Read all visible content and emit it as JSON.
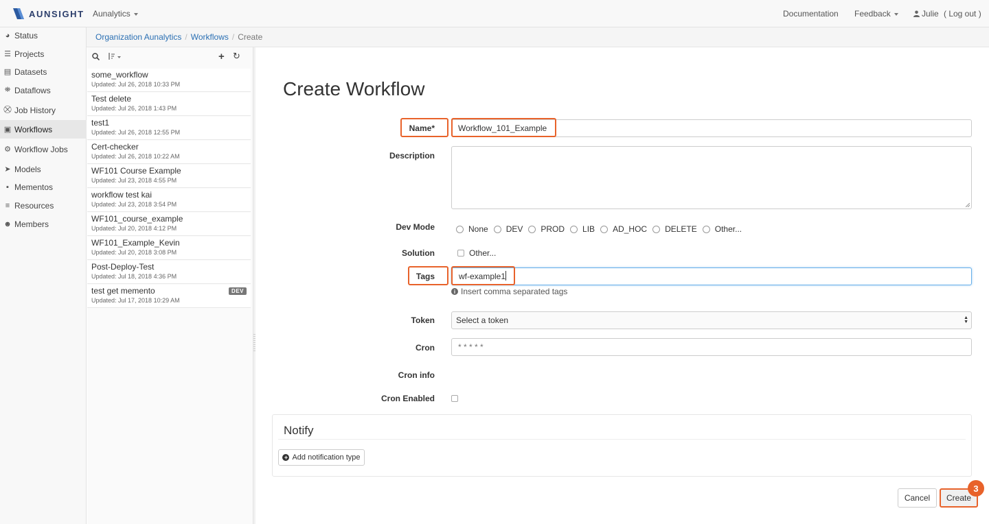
{
  "navbar": {
    "brand": "AUNSIGHT",
    "org_menu": "Aunalytics",
    "documentation": "Documentation",
    "feedback": "Feedback",
    "user": "Julie",
    "logout": "( Log out )"
  },
  "breadcrumb": {
    "items": [
      "Organization Aunalytics",
      "Workflows"
    ],
    "current": "Create"
  },
  "sidebar": {
    "items": [
      {
        "label": "Status",
        "icon": "dashboard-icon"
      },
      {
        "label": "Projects",
        "icon": "list-icon"
      },
      {
        "label": "Datasets",
        "icon": "document-icon"
      },
      {
        "label": "Dataflows",
        "icon": "sitemap-icon"
      },
      {
        "label": "Job History",
        "icon": "job-history-icon"
      },
      {
        "label": "Workflows",
        "icon": "workflow-icon"
      },
      {
        "label": "Workflow Jobs",
        "icon": "workflow-jobs-icon"
      },
      {
        "label": "Models",
        "icon": "models-icon"
      },
      {
        "label": "Mementos",
        "icon": "bookmark-icon"
      },
      {
        "label": "Resources",
        "icon": "resources-icon"
      },
      {
        "label": "Members",
        "icon": "users-icon"
      }
    ],
    "active": "Workflows"
  },
  "workflow_list": {
    "items": [
      {
        "name": "some_workflow",
        "updated": "Updated:  Jul 26, 2018 10:33 PM"
      },
      {
        "name": "Test delete",
        "updated": "Updated:  Jul 26, 2018 1:43 PM"
      },
      {
        "name": "test1",
        "updated": "Updated:  Jul 26, 2018 12:55 PM"
      },
      {
        "name": "Cert-checker",
        "updated": "Updated:  Jul 26, 2018 10:22 AM"
      },
      {
        "name": "WF101 Course Example",
        "updated": "Updated:  Jul 23, 2018 4:55 PM"
      },
      {
        "name": "workflow test kai",
        "updated": "Updated:  Jul 23, 2018 3:54 PM"
      },
      {
        "name": "WF101_course_example",
        "updated": "Updated:  Jul 20, 2018 4:12 PM"
      },
      {
        "name": "WF101_Example_Kevin",
        "updated": "Updated:  Jul 20, 2018 3:08 PM"
      },
      {
        "name": "Post-Deploy-Test",
        "updated": "Updated:  Jul 18, 2018 4:36 PM"
      },
      {
        "name": "test get memento",
        "updated": "Updated:  Jul 17, 2018 10:29 AM",
        "badge": "DEV"
      }
    ]
  },
  "form": {
    "title": "Create Workflow",
    "name_label": "Name*",
    "name_value": "Workflow_101_Example",
    "description_label": "Description",
    "description_value": "",
    "devmode_label": "Dev Mode",
    "devmode_options": [
      "None",
      "DEV",
      "PROD",
      "LIB",
      "AD_HOC",
      "DELETE",
      "Other..."
    ],
    "solution_label": "Solution",
    "solution_other": "Other...",
    "tags_label": "Tags",
    "tags_value": "wf-example1",
    "tags_help": "Insert comma separated tags",
    "token_label": "Token",
    "token_selected": "Select a token",
    "cron_label": "Cron",
    "cron_placeholder": "* * * * *",
    "cron_info_label": "Cron info",
    "cron_enabled_label": "Cron Enabled"
  },
  "notify": {
    "title": "Notify",
    "add_button": "Add notification type"
  },
  "actions": {
    "cancel": "Cancel",
    "create": "Create",
    "step_number": "3"
  },
  "colors": {
    "highlight": "#e8622a",
    "link": "#2a6fb3",
    "brand": "#2c3e6b"
  }
}
